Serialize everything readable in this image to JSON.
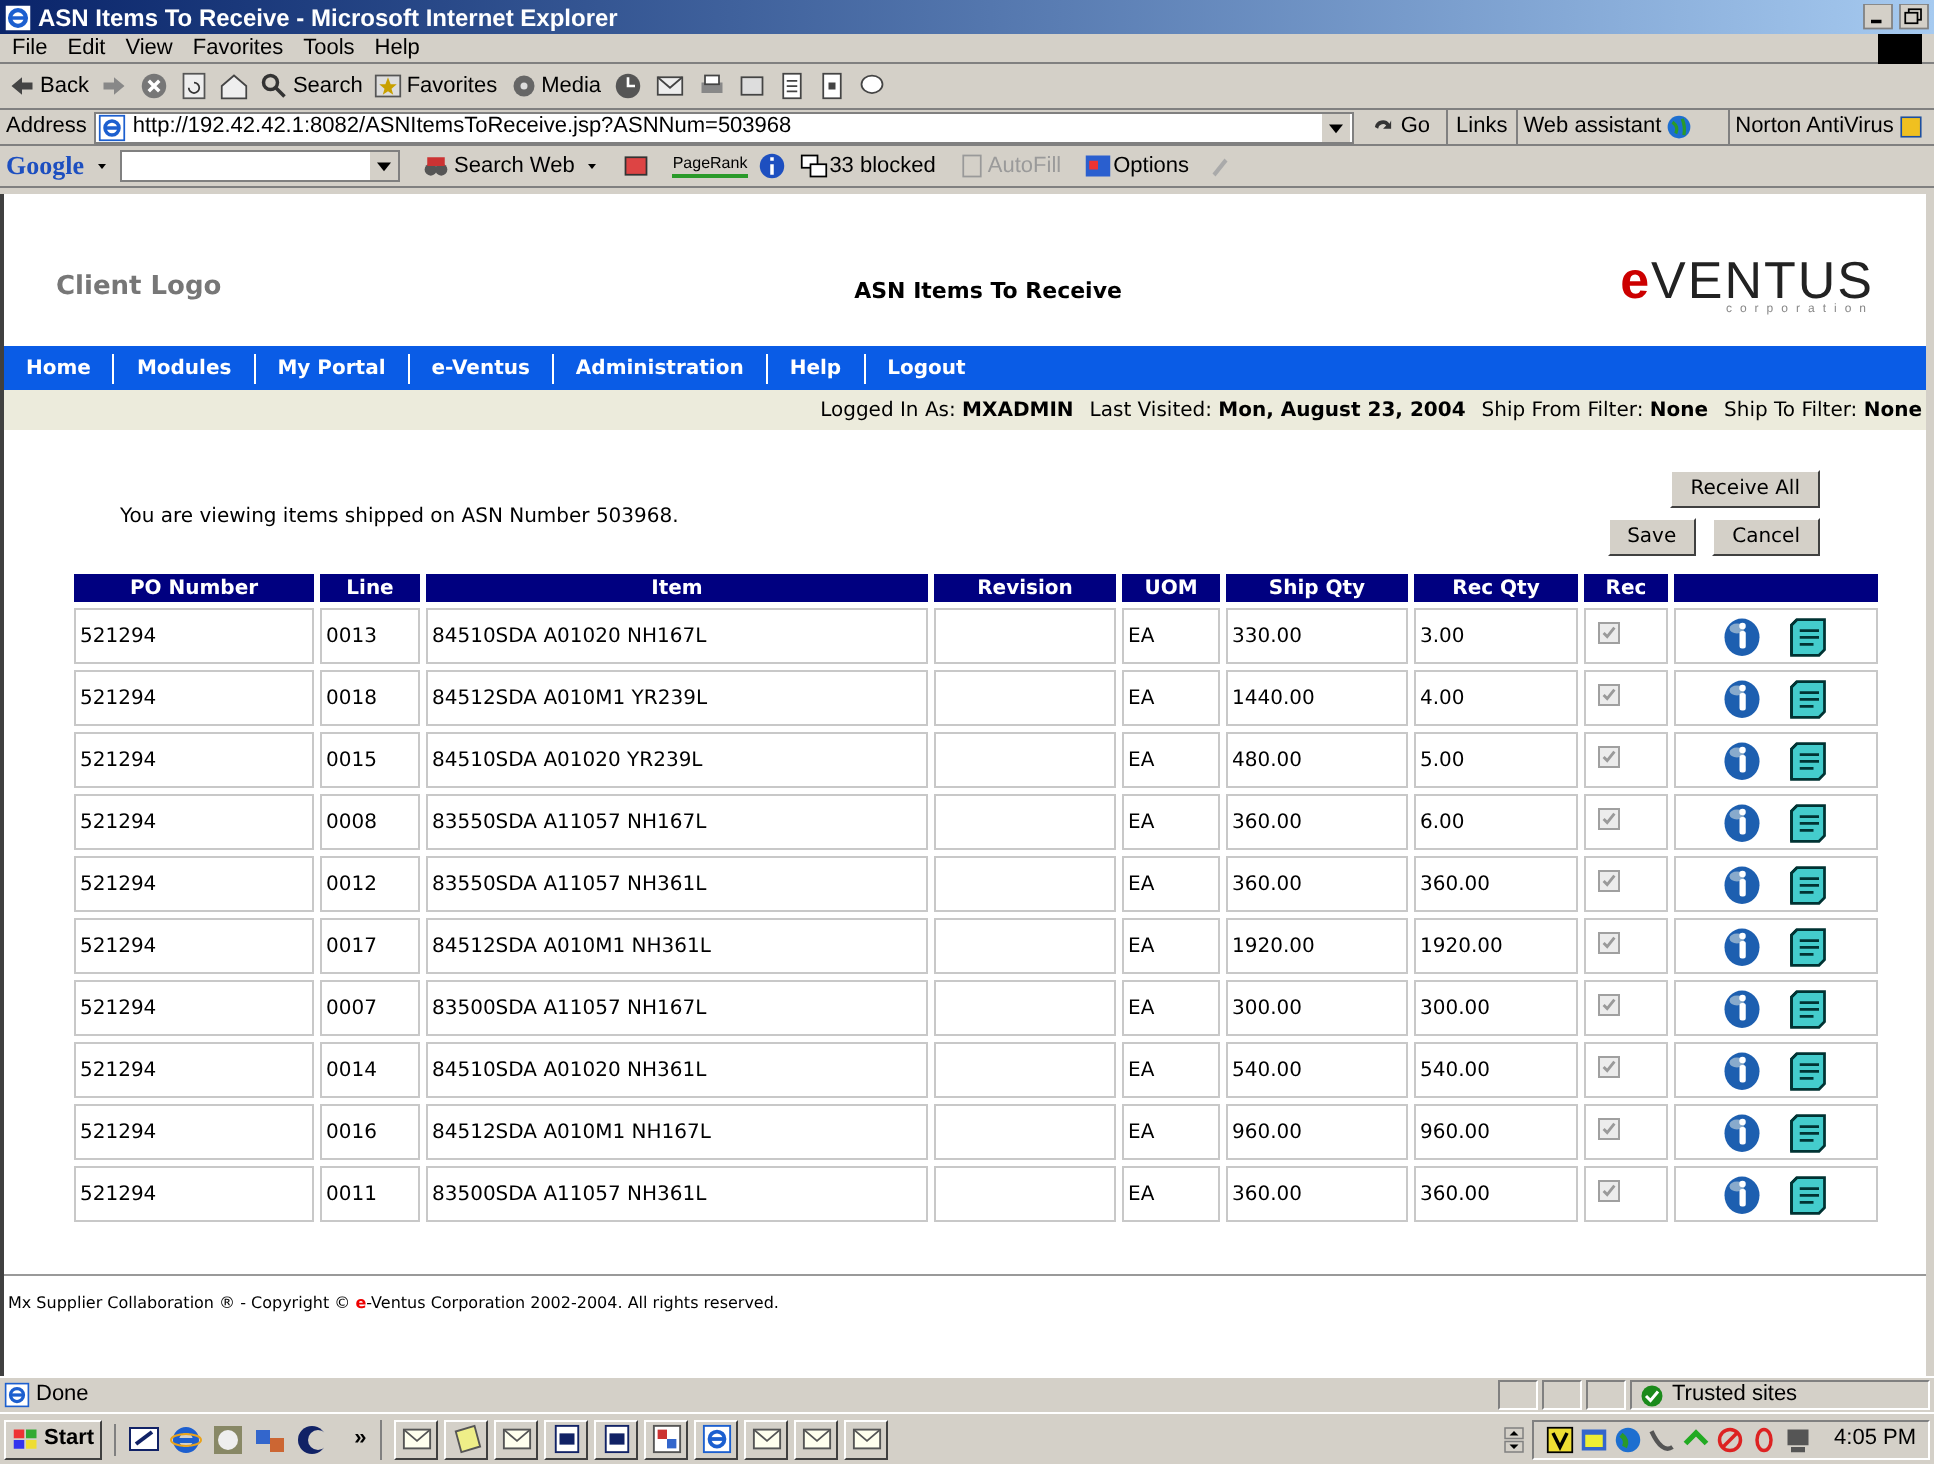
{
  "window": {
    "title": "ASN Items To Receive - Microsoft Internet Explorer"
  },
  "menu": [
    "File",
    "Edit",
    "View",
    "Favorites",
    "Tools",
    "Help"
  ],
  "toolbar": {
    "back": "Back",
    "search": "Search",
    "favorites": "Favorites",
    "media": "Media"
  },
  "address_bar": {
    "label": "Address",
    "url": "http://192.42.42.1:8082/ASNItemsToReceive.jsp?ASNNum=503968",
    "go": "Go",
    "links": "Links",
    "web_assistant": "Web assistant",
    "norton": "Norton AntiVirus"
  },
  "google_bar": {
    "logo": "Google",
    "search_web": "Search Web",
    "pagerank": "PageRank",
    "blocked": "33 blocked",
    "autofill": "AutoFill",
    "autofill_disabled": true,
    "options": "Options"
  },
  "header": {
    "client_logo": "Client Logo",
    "title": "ASN Items To Receive",
    "logo": {
      "mark": "e",
      "name": "VENTUS",
      "tagline": "corporation"
    }
  },
  "nav": [
    "Home",
    "Modules",
    "My Portal",
    "e-Ventus",
    "Administration",
    "Help",
    "Logout"
  ],
  "info_bar": [
    {
      "label": "Logged In As:",
      "value": "MXADMIN"
    },
    {
      "label": "Last Visited:",
      "value": "Mon, August 23, 2004"
    },
    {
      "label": "Ship From Filter:",
      "value": "None"
    },
    {
      "label": "Ship To Filter:",
      "value": "None"
    }
  ],
  "message": "You are viewing items shipped on ASN Number 503968.",
  "buttons": {
    "receive_all": "Receive All",
    "save": "Save",
    "cancel": "Cancel"
  },
  "table": {
    "columns": [
      "PO Number",
      "Line",
      "Item",
      "Revision",
      "UOM",
      "Ship Qty",
      "Rec Qty",
      "Rec"
    ],
    "rows": [
      {
        "po": "521294",
        "line": "0013",
        "item": "84510SDA A01020 NH167L",
        "uom": "EA",
        "ship_qty": "330.00",
        "rec_qty": "3.00",
        "checked": true,
        "disabled": true
      },
      {
        "po": "521294",
        "line": "0018",
        "item": "84512SDA A010M1 YR239L",
        "uom": "EA",
        "ship_qty": "1440.00",
        "rec_qty": "4.00",
        "checked": true,
        "disabled": true
      },
      {
        "po": "521294",
        "line": "0015",
        "item": "84510SDA A01020 YR239L",
        "uom": "EA",
        "ship_qty": "480.00",
        "rec_qty": "5.00",
        "checked": true,
        "disabled": true
      },
      {
        "po": "521294",
        "line": "0008",
        "item": "83550SDA A11057 NH167L",
        "uom": "EA",
        "ship_qty": "360.00",
        "rec_qty": "6.00",
        "checked": true,
        "disabled": true
      },
      {
        "po": "521294",
        "line": "0012",
        "item": "83550SDA A11057 NH361L",
        "uom": "EA",
        "ship_qty": "360.00",
        "rec_qty": "360.00",
        "checked": true,
        "disabled": true
      },
      {
        "po": "521294",
        "line": "0017",
        "item": "84512SDA A010M1 NH361L",
        "uom": "EA",
        "ship_qty": "1920.00",
        "rec_qty": "1920.00",
        "checked": true,
        "disabled": true
      },
      {
        "po": "521294",
        "line": "0007",
        "item": "83500SDA A11057 NH167L",
        "uom": "EA",
        "ship_qty": "300.00",
        "rec_qty": "300.00",
        "checked": true,
        "disabled": true
      },
      {
        "po": "521294",
        "line": "0014",
        "item": "84510SDA A01020 NH361L",
        "uom": "EA",
        "ship_qty": "540.00",
        "rec_qty": "540.00",
        "checked": true,
        "disabled": true
      },
      {
        "po": "521294",
        "line": "0016",
        "item": "84512SDA A010M1 NH167L",
        "uom": "EA",
        "ship_qty": "960.00",
        "rec_qty": "960.00",
        "checked": true,
        "disabled": true
      },
      {
        "po": "521294",
        "line": "0011",
        "item": "83500SDA A11057 NH361L",
        "uom": "EA",
        "ship_qty": "360.00",
        "rec_qty": "360.00",
        "checked": true,
        "disabled": true
      }
    ]
  },
  "footer": {
    "before": "Mx Supplier Collaboration ® - Copyright © ",
    "brand_mark": "e",
    "after": "-Ventus Corporation 2002-2004. All rights reserved."
  },
  "status_bar": {
    "text": "Done",
    "zone": "Trusted sites"
  },
  "taskbar": {
    "start": "Start",
    "more": "»",
    "clock": "4:05 PM"
  }
}
